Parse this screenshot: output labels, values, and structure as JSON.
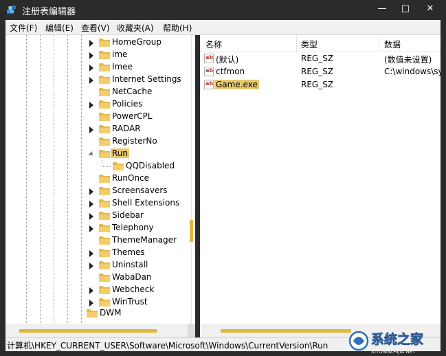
{
  "window": {
    "title": "注册表编辑器",
    "minimize_glyph": "—",
    "maximize_glyph": "□",
    "close_glyph": "✕"
  },
  "menu": [
    "文件(F)",
    "编辑(E)",
    "查看(V)",
    "收藏夹(A)",
    "帮助(H)"
  ],
  "tree": {
    "items": [
      {
        "label": "HomeGroup",
        "expandable": true
      },
      {
        "label": "ime",
        "expandable": true
      },
      {
        "label": "Imee",
        "expandable": true
      },
      {
        "label": "Internet Settings",
        "expandable": true
      },
      {
        "label": "NetCache",
        "expandable": false
      },
      {
        "label": "Policies",
        "expandable": true
      },
      {
        "label": "PowerCPL",
        "expandable": false
      },
      {
        "label": "RADAR",
        "expandable": true
      },
      {
        "label": "RegisterNo",
        "expandable": false
      },
      {
        "label": "Run",
        "expandable": true,
        "expanded": true,
        "selected": true
      },
      {
        "label": "QQDisabled",
        "expandable": false,
        "child": true
      },
      {
        "label": "RunOnce",
        "expandable": false
      },
      {
        "label": "Screensavers",
        "expandable": true
      },
      {
        "label": "Shell Extensions",
        "expandable": true
      },
      {
        "label": "Sidebar",
        "expandable": true
      },
      {
        "label": "Telephony",
        "expandable": true
      },
      {
        "label": "ThemeManager",
        "expandable": false
      },
      {
        "label": "Themes",
        "expandable": true
      },
      {
        "label": "Uninstall",
        "expandable": true
      },
      {
        "label": "WabaDan",
        "expandable": false
      },
      {
        "label": "Webcheck",
        "expandable": true
      },
      {
        "label": "WinTrust",
        "expandable": true
      }
    ],
    "bottom_item": "DWM"
  },
  "list": {
    "columns": {
      "name": "名称",
      "type": "类型",
      "data": "数据"
    },
    "rows": [
      {
        "name": "(默认)",
        "type": "REG_SZ",
        "data": "(数值未设置)"
      },
      {
        "name": "ctfmon",
        "type": "REG_SZ",
        "data": "C:\\windows\\sys"
      },
      {
        "name": "Game.exe",
        "type": "REG_SZ",
        "data": "",
        "selected": true
      }
    ],
    "icon_text": "ab"
  },
  "status": {
    "path": "计算机\\HKEY_CURRENT_USER\\Software\\Microsoft\\Windows\\CurrentVersion\\Run"
  },
  "watermark": {
    "text": "系统之家",
    "subtext": "XITONGZHIJIA.NET"
  },
  "colors": {
    "accent": "#e0b83c",
    "selection": "#e8c96a",
    "titlebar": "#2b2b2b",
    "folder": "#e6b84a"
  }
}
